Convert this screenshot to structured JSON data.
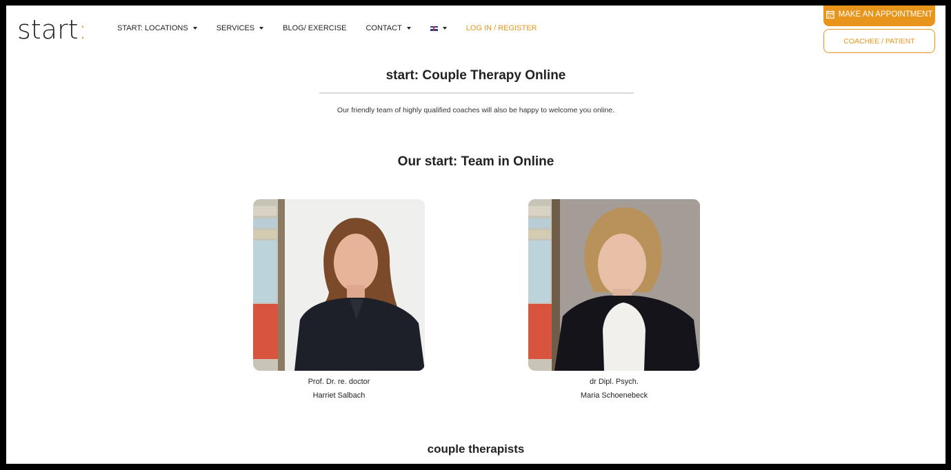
{
  "header": {
    "logo_text": "start",
    "logo_colon": ":",
    "nav": [
      {
        "label": "START: LOCATIONS",
        "dropdown": true
      },
      {
        "label": "SERVICES",
        "dropdown": true
      },
      {
        "label": "BLOG/ EXERCISE",
        "dropdown": false
      },
      {
        "label": "CONTACT",
        "dropdown": true
      }
    ],
    "language_icon": "uk-flag-icon",
    "login_label": "LOG IN / REGISTER",
    "appointment_label": "MAKE AN APPOINTMENT",
    "appointment_icon": "calendar-icon",
    "coachee_label": "COACHEE / PATIENT",
    "accent_color": "#e8951c"
  },
  "main": {
    "title": "start: Couple Therapy Online",
    "intro": "Our friendly team of highly qualified coaches will also be happy to welcome you online.",
    "team_heading": "Our start: Team in Online",
    "team": [
      {
        "title_line": "Prof. Dr. re. doctor",
        "name": "Harriet Salbach"
      },
      {
        "title_line": "dr Dipl. Psych.",
        "name": "Maria Schoenebeck"
      }
    ],
    "next_section": "couple therapists"
  }
}
